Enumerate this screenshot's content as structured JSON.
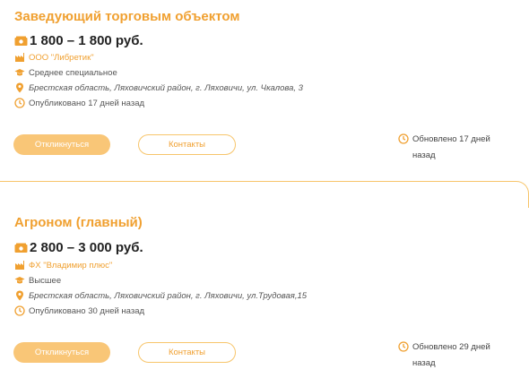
{
  "colors": {
    "accent": "#f0a030",
    "button_fill": "#f9c677",
    "border": "#f7c56b"
  },
  "vacancies": [
    {
      "title": "Заведующий торговым объектом",
      "salary": "1 800 – 1 800 руб.",
      "company": "ООО \"Либретик\"",
      "education": "Среднее специальное",
      "address": "Брестская область, Ляховичский район, г. Ляховичи, ул. Чкалова, 3",
      "published": "Опубликовано 17 дней назад",
      "apply_label": "Откликнуться",
      "contacts_label": "Контакты",
      "updated": "Обновлено 17 дней назад"
    },
    {
      "title": "Агроном (главный)",
      "salary": "2 800 – 3 000 руб.",
      "company": "ФХ \"Владимир плюс\"",
      "education": "Высшее",
      "address": "Брестская область, Ляховичский район, г. Ляховичи, ул.Трудовая,15",
      "published": "Опубликовано 30 дней назад",
      "apply_label": "Откликнуться",
      "contacts_label": "Контакты",
      "updated": "Обновлено 29 дней назад"
    }
  ],
  "icons": {
    "salary": "money-icon",
    "company": "factory-icon",
    "education": "graduation-cap-icon",
    "address": "location-pin-icon",
    "published": "clock-icon",
    "updated": "clock-icon"
  }
}
